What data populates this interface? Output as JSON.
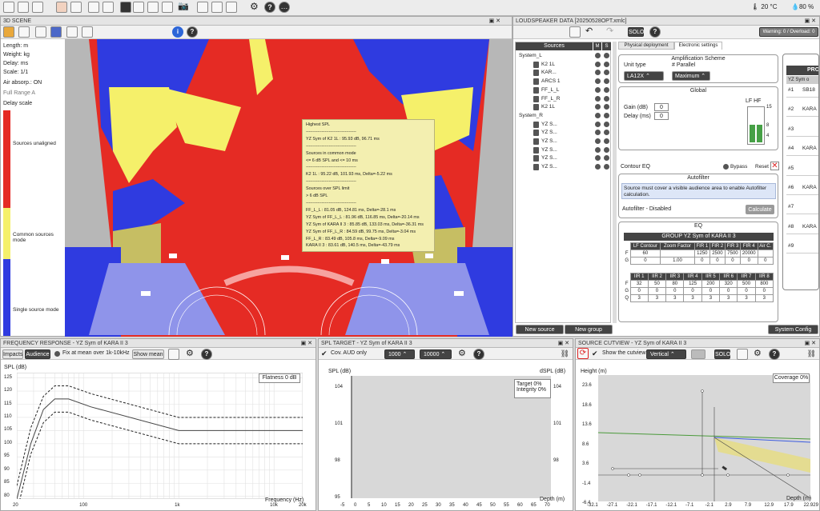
{
  "status": {
    "temp": "20 °C",
    "humidity": "80 %"
  },
  "scene": {
    "title": "3D SCENE",
    "info": [
      "Length: m",
      "Weight: kg",
      "Delay: ms",
      "Scale: 1/1",
      "Air absorp.: ON"
    ],
    "mode": "Full Range A",
    "scale_title": "Delay scale",
    "scale_labels": [
      "Sources unaligned",
      "Common sources mode",
      "Single source mode"
    ]
  },
  "tooltip": {
    "lines": [
      "Highest SPL",
      "-----------------------------------",
      "YZ Sym of  K2 1L : 95.93 dB, 96.71 ms",
      "-----------------------------------",
      "Sources in common mode",
      "<= 6 dB SPL and <= 10 ms",
      "-----------------------------------",
      " K2 1L : 95.22 dB, 101.93 ms, Delta=-5.22 ms",
      "-----------------------------------",
      "Sources over SPL limit",
      "> 6 dB SPL",
      "-----------------------------------",
      "FF_L_L : 81.05 dB, 124.81 ms, Delta=-28.1 ms",
      "YZ Sym of FF_L_L : 81.96 dB, 116.85 ms, Delta=-20.14 ms",
      "YZ Sym of KARA II 3 : 85.85 dB, 133.03 ms, Delta=-36.31 ms",
      "YZ Sym of FF_L_R : 84.59 dB, 99.75 ms, Delta=-3.04 ms",
      "FF_L_R : 83.49 dB, 105.8 ms, Delta=-9.09 ms",
      "KARA II 3 : 83.61 dB, 140.5 ms, Delta=-43.79 ms"
    ]
  },
  "lsdata": {
    "title": "LOUDSPEAKER DATA [20250528OPT.xmlc]",
    "solo": "SOLO",
    "warning": "Warning: 0 / Overload: 0",
    "sources_header": "Sources",
    "col_m": "M",
    "col_s": "S",
    "tree": [
      {
        "label": "System_L",
        "level": 0
      },
      {
        "label": "K2 1L",
        "level": 2
      },
      {
        "label": "KAR...",
        "level": 2
      },
      {
        "label": "ARCS 1",
        "level": 2
      },
      {
        "label": "FF_L_L",
        "level": 2
      },
      {
        "label": "FF_L_R",
        "level": 2
      },
      {
        "label": "K2 1L",
        "level": 2
      },
      {
        "label": "System_R",
        "level": 0
      },
      {
        "label": "YZ S...",
        "level": 2
      },
      {
        "label": "YZ S...",
        "level": 2
      },
      {
        "label": "YZ S...",
        "level": 2
      },
      {
        "label": "YZ S...",
        "level": 2
      },
      {
        "label": "YZ S...",
        "level": 2
      },
      {
        "label": "YZ S...",
        "level": 2
      }
    ],
    "new_source": "New source",
    "new_group": "New group",
    "system_config": "System Config",
    "tabs": [
      "Physical deployment",
      "Electronic settings"
    ],
    "amp_title": "Amplification Scheme",
    "unit_type_label": "Unit type",
    "parallel_label": "# Parallel",
    "unit_type": "LA12X",
    "parallel": "Maximum",
    "global_title": "Global",
    "gain_label": "Gain (dB)",
    "gain": "0",
    "delay_label": "Delay (ms)",
    "delay": "0",
    "meter_label": "LF HF",
    "meter_ticks": [
      "15",
      "8",
      "4"
    ],
    "contour_label": "Contour EQ",
    "bypass_label": "Bypass",
    "reset_label": "Reset",
    "autofilter_title": "Autofilter",
    "autofilter_msg": "Source must cover a visible audience area to enable Autofilter calculation.",
    "autofilter_status": "Autofilter - Disabled",
    "calculate": "Calculate",
    "eq_title": "EQ",
    "eq_group": "GROUP YZ Sym of KARA II 3",
    "eq_head1": [
      "LF Contour",
      "Zoom Factor",
      "FIR 1",
      "FIR 2",
      "FIR 3",
      "FIR 4",
      "Air C."
    ],
    "eq_f1": [
      "60",
      "",
      "1250",
      "2500",
      "7500",
      "20000",
      ""
    ],
    "eq_g1": [
      "0",
      "1.00",
      "0",
      "0",
      "0",
      "0",
      "0"
    ],
    "eq_head2": [
      "IIR 1",
      "IIR 2",
      "IIR 3",
      "IIR 4",
      "IIR 5",
      "IIR 6",
      "IIR 7",
      "IIR 8"
    ],
    "eq_f2": [
      "32",
      "50",
      "80",
      "125",
      "200",
      "320",
      "500",
      "800"
    ],
    "eq_g2": [
      "0",
      "0",
      "0",
      "0",
      "0",
      "0",
      "0",
      "0"
    ],
    "eq_q2": [
      "3",
      "3",
      "3",
      "3",
      "3",
      "3",
      "3",
      "3"
    ],
    "side_header": "PRO",
    "side_sub": "YZ Sym o",
    "side_rows": [
      {
        "n": "#1",
        "v": "SB18"
      },
      {
        "n": "#2",
        "v": "KARA"
      },
      {
        "n": "#3",
        "v": ""
      },
      {
        "n": "#4",
        "v": "KARA"
      },
      {
        "n": "#5",
        "v": ""
      },
      {
        "n": "#6",
        "v": "KARA"
      },
      {
        "n": "#7",
        "v": ""
      },
      {
        "n": "#8",
        "v": "KARA"
      },
      {
        "n": "#9",
        "v": ""
      }
    ]
  },
  "freq": {
    "title": "FREQUENCY RESPONSE - YZ Sym of KARA II 3",
    "impacts": "Impacts",
    "audience": "Audience",
    "fix_label": "Fix at mean over 1k-10kHz",
    "show_mean": "Show mean",
    "ylabel": "SPL (dB)",
    "xlabel": "Frequency (Hz)",
    "flatness": "Flatness 0 dB",
    "yticks": [
      "125",
      "120",
      "115",
      "110",
      "105",
      "100",
      "95",
      "90",
      "85",
      "80"
    ],
    "xticks": [
      "20",
      "100",
      "1k",
      "10k",
      "20k"
    ]
  },
  "spl": {
    "title": "SPL TARGET - YZ Sym of KARA II 3",
    "cov_label": "Cov. AUD only",
    "freq_from": "1000",
    "freq_to": "10000",
    "ylabel": "SPL (dB)",
    "y2label": "dSPL (dB)",
    "target": "Target 0%",
    "integrity": "Integrity 0%",
    "yticks": [
      "104",
      "101",
      "98",
      "95"
    ],
    "y2ticks": [
      "104",
      "101",
      "98"
    ],
    "xticks": [
      "-5",
      "0",
      "5",
      "10",
      "15",
      "20",
      "25",
      "30",
      "35",
      "40",
      "45",
      "50",
      "55",
      "60",
      "65",
      "70"
    ],
    "xlabel": "Depth (m)"
  },
  "cut": {
    "title": "SOURCE CUTVIEW - YZ Sym of KARA II 3",
    "show_label": "Show the cutview",
    "orientation": "Vertical",
    "solo": "SOLO",
    "coverage": "Coverage 0%",
    "ylabel": "Height (m)",
    "yticks": [
      "23.6",
      "18.6",
      "13.6",
      "8.6",
      "3.6",
      "-1.4",
      "-6.4"
    ],
    "xticks": [
      "-32.1",
      "-27.1",
      "-22.1",
      "-17.1",
      "-12.1",
      "-7.1",
      "-2.1",
      "2.9",
      "7.9",
      "12.9",
      "17.9",
      "22.929"
    ],
    "xlabel": "Depth (m)"
  },
  "colors": {
    "red": "#e52b24",
    "yellow": "#f5f06a",
    "blue": "#2f3be0",
    "gray": "#b7b7b7"
  }
}
